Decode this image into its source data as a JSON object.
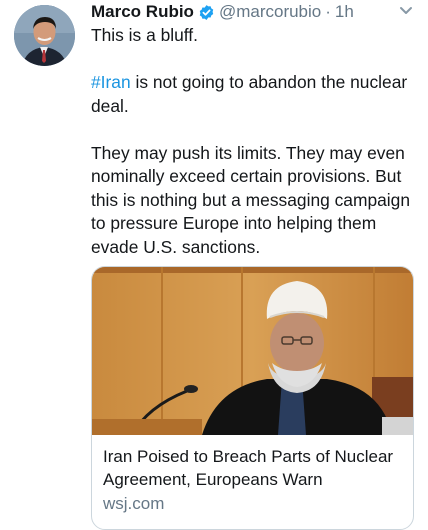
{
  "tweet": {
    "author": {
      "name": "Marco Rubio",
      "handle": "@marcorubio",
      "verified": true,
      "avatar_icon": "profile-photo"
    },
    "separator": "·",
    "time": "1h",
    "menu_icon": "chevron-down-icon",
    "body": {
      "line1": "This is a bluff.",
      "hashtag": "#Iran",
      "para2_rest": " is not going to abandon the nuclear deal.",
      "para3": "They may push its limits. They may even nominally exceed certain provisions. But this is nothing but a messaging campaign to pressure Europe into helping them evade U.S. sanctions."
    },
    "card": {
      "image_icon": "news-photo",
      "title": "Iran Poised to Breach Parts of Nuclear Agreement, Europeans Warn",
      "domain": "wsj.com"
    }
  },
  "colors": {
    "text": "#14171a",
    "secondary": "#657786",
    "link": "#1b95e0",
    "verified": "#1da1f2"
  }
}
